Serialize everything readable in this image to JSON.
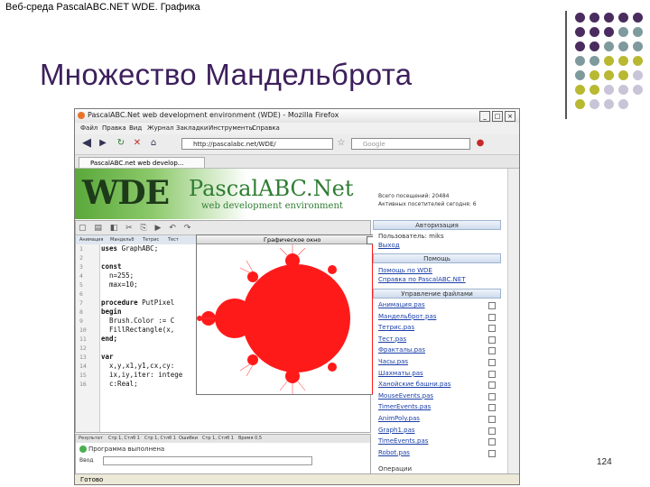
{
  "slide": {
    "caption": "Веб-среда PascalABC.NET WDE. Графика",
    "title": "Множество Мандельброта",
    "page_number": "124",
    "colors": {
      "title": "#3d1f5c",
      "dot_purple": "#4a2c5e",
      "dot_teal": "#7f9a9c",
      "dot_olive": "#b8b832",
      "dot_lavender": "#c9c4d8"
    }
  },
  "browser": {
    "window_title": "PascalABC.Net web development environment (WDE) - Mozilla Firefox",
    "menu": [
      "Файл",
      "Правка",
      "Вид",
      "Журнал",
      "Закладки",
      "Инструменты",
      "Справка"
    ],
    "url": "http://pascalabc.net/WDE/",
    "search_placeholder": "Google",
    "tab_label": "PascalABC.net web develop...",
    "status": "Готово"
  },
  "wde": {
    "logo": "WDE",
    "product_name": "PascalABC.Net",
    "subtitle": "web development environment",
    "visits": [
      "Всего посещений: 20484",
      "Активных посетителей сегодня: 6"
    ]
  },
  "editor": {
    "tabs": [
      "Анимация",
      "Мандельб",
      "Тетрис",
      "Тест"
    ],
    "lines": [
      [
        "1",
        "uses GraphABC;"
      ],
      [
        "2",
        ""
      ],
      [
        "3",
        "const"
      ],
      [
        "4",
        "  n=255;"
      ],
      [
        "5",
        "  max=10;"
      ],
      [
        "6",
        ""
      ],
      [
        "7",
        "procedure PutPixel"
      ],
      [
        "8",
        "begin"
      ],
      [
        "9",
        "  Brush.Color := C"
      ],
      [
        "10",
        "  FillRectangle(x,"
      ],
      [
        "11",
        "end;"
      ],
      [
        "12",
        ""
      ],
      [
        "13",
        "var"
      ],
      [
        "14",
        "  x,y,x1,y1,cx,cy:"
      ],
      [
        "15",
        "  ix,iy,iter: intege"
      ],
      [
        "16",
        "  c:Real;"
      ]
    ]
  },
  "graphics_window": {
    "title": "Графическое окно"
  },
  "output": {
    "tabs": [
      "Результат",
      "Стр 1, Стлб 1",
      "Стр 1, Стлб 1",
      "Ошибки",
      "Стр 1, Стлб 1",
      "Время 0,5"
    ],
    "message": "Программа выполнена",
    "input_label": "Ввод"
  },
  "right_panel": {
    "auth_header": "Авторизация",
    "user_label": "Пользователь: miks",
    "user_link": "Выход",
    "help_header": "Помощь",
    "help_link": "Помощь по WDE",
    "help_link2": "Справка по PascalABC.NET",
    "files_header": "Управление файлами",
    "files": [
      "Анимация.pas",
      "Мандельброт.pas",
      "Тетрис.pas",
      "Тест.pas",
      "Фракталы.pas",
      "Часы.pas",
      "Шахматы.pas",
      "Ханойские башни.pas",
      "MouseEvents.pas",
      "TimerEvents.pas",
      "AnimPoly.pas",
      "Graph1.pas",
      "TimeEvents.pas",
      "Robot.pas"
    ],
    "operations_header": "Операции"
  }
}
